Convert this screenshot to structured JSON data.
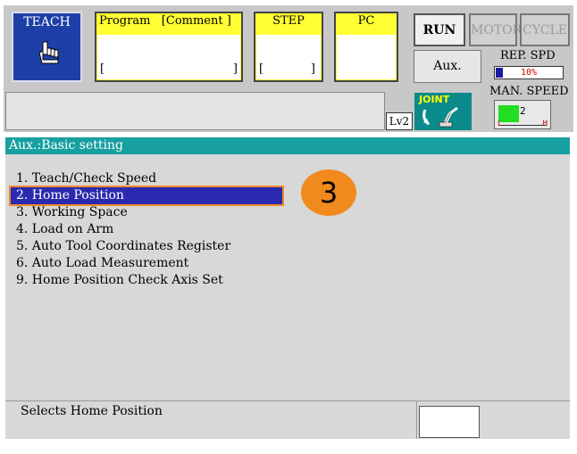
{
  "header": {
    "teach_label": "TEACH",
    "program_header": "Program   [Comment ]",
    "program_bracket_left": "[",
    "program_bracket_right": "]",
    "step_header": "STEP",
    "step_bracket_left": "[",
    "step_bracket_right": "]",
    "pc_header": "PC"
  },
  "controls": {
    "run_label": "RUN",
    "motor_label": "MOTOR",
    "cycle_label": "CYCLE",
    "aux_label": "Aux.",
    "rep_spd_label": "REP. SPD",
    "rep_spd_value": "10%",
    "rep_spd_fraction": 0.1,
    "man_speed_label": "MAN. SPEED",
    "man_speed_value": "2",
    "man_low_label": "L",
    "man_high_label": "H",
    "level_label": "Lv2",
    "joint_label": "JOINT"
  },
  "title": "Aux.:Basic setting",
  "menu": {
    "items": [
      "1. Teach/Check Speed",
      "2. Home Position",
      "3. Working Space",
      "4. Load on Arm",
      "5. Auto Tool Coordinates Register",
      "6. Auto Load Measurement",
      "9. Home Position Check Axis Set"
    ],
    "selected_index": 1
  },
  "badge": "3",
  "status": {
    "text": "Selects Home Position"
  },
  "colors": {
    "teach_bg": "#1f3fa8",
    "field_header": "#ffff33",
    "title_bar": "#18a0a0",
    "selection": "#2a2ab0",
    "highlight_outline": "#f08a2a",
    "badge": "#f08a1c"
  }
}
